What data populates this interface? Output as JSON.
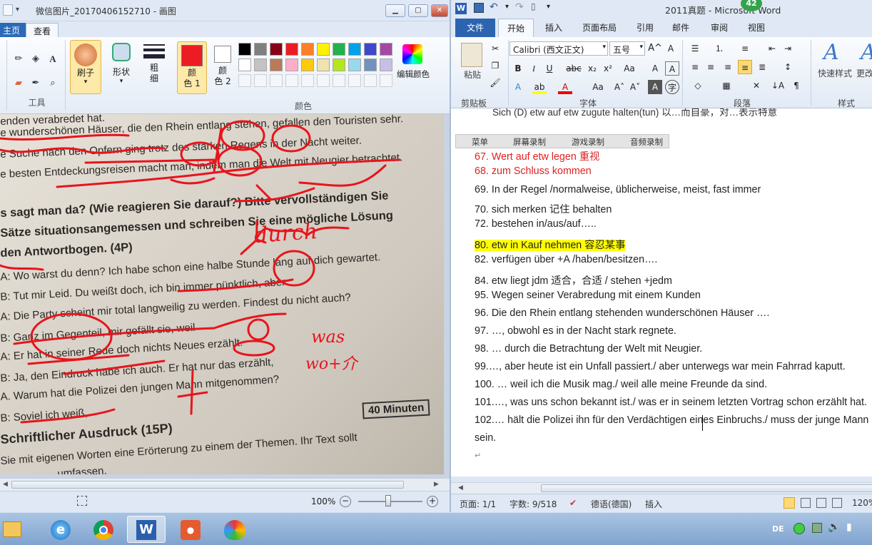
{
  "paint": {
    "title": "微信图片_20170406152710 - 画图",
    "tabs": [
      "主页",
      "查看"
    ],
    "tools_group": "工具",
    "brush_label": "刷子",
    "shapes_label": "形状",
    "size_label": "粗\n细",
    "color1_label": "颜\n色 1",
    "color2_label": "颜\n色 2",
    "colors_group": "颜色",
    "edit_colors_label": "编辑颜色",
    "zoom": "100%",
    "palette": [
      "#000000",
      "#7f7f7f",
      "#880015",
      "#ed1c24",
      "#ff7f27",
      "#fff200",
      "#22b14c",
      "#00a2e8",
      "#3f48cc",
      "#a349a4",
      "#ffffff",
      "#c3c3c3",
      "#b97a57",
      "#ffaec9",
      "#ffc90e",
      "#efe4b0",
      "#b5e61d",
      "#99d9ea",
      "#7092be",
      "#c8bfe7"
    ],
    "color1": "#ed1c24",
    "color2": "#ffffff",
    "photo_lines": [
      "enden verabredet hat.",
      "e wunderschönen Häuser, die den Rhein entlang stehen, gefallen den Touristen sehr.",
      "e Suche nach den Opfern ging trotz des starken Regens in der Nacht weiter.",
      "e besten Entdeckungsreisen macht man, indem man die Welt mit Neugier betrachtet.",
      "s sagt man da? (Wie reagieren Sie darauf?) Bitte vervollständigen Sie",
      "Sätze situationsangemessen und schreiben Sie eine mögliche Lösung",
      "den Antwortbogen. (4P)",
      "A: Wo warst du denn? Ich habe schon eine halbe Stunde lang auf dich gewartet.",
      "B: Tut mir Leid. Du weißt doch, ich bin immer pünktlich, aber",
      "A: Die Party scheint mir total langweilig zu werden. Findest du nicht auch?",
      "B: Ganz im Gegenteil, mir gefällt sie, weil",
      "A: Er hat in seiner Rede doch nichts Neues erzählt.",
      "B: Ja, den Eindruck habe ich auch. Er hat nur das erzählt,",
      "A. Warum hat die Polizei den jungen Mann mitgenommen?",
      "B: Soviel ich weiß,",
      "Schriftlicher Ausdruck  (15P)",
      "Sie mit eigenen Worten eine Erörterung zu einem der Themen. Ihr Text sollt",
      "umfassen."
    ],
    "minuten_box": "40 Minuten",
    "handwriting": [
      "durch",
      "was",
      "wo+介"
    ]
  },
  "word": {
    "title": "2011真题 - Microsoft Word",
    "badge": "42",
    "tabs": [
      "文件",
      "开始",
      "插入",
      "页面布局",
      "引用",
      "邮件",
      "审阅",
      "视图"
    ],
    "font_name": "Calibri (西文正文)",
    "font_size": "五号",
    "paste_label": "粘贴",
    "clipboard_group": "剪贴板",
    "font_group": "字体",
    "paragraph_group": "段落",
    "styles_group": "样式",
    "quick_styles": "快速样式",
    "change_styles": "更改",
    "recorder": [
      "菜单",
      "屏幕录制",
      "游戏录制",
      "音频录制"
    ],
    "doc_top_partial": "Sich (D) etw auf etw zugute halten(tun)  以…而自豪，对…表示特意",
    "doc_lines": [
      "67.   Wert auf etw legen  重视",
      "68. zum Schluss kommen",
      "69.   In der Regel /normalweise, üblicherweise, meist, fast immer",
      "70.     sich merken  记住  behalten",
      "72. bestehen in/aus/auf…..",
      "80. etw in Kauf nehmen  容忍某事",
      "82. verfügen über +A /haben/besitzen….",
      "84. etw liegt jdm  适合，合适     / stehen +jedm",
      "95. Wegen seiner Verabredung mit einem Kunden",
      "96. Die den Rhein entlang stehenden wunderschönen Häuser ….",
      "97. …, obwohl es in der Nacht stark regnete.",
      "98. … durch die Betrachtung der Welt mit Neugier.",
      "99.…, aber heute ist ein Unfall passiert./ aber unterwegs war mein Fahrrad kaputt.",
      "100. … weil ich die Musik mag./ weil alle meine Freunde da sind.",
      "101.…, was uns schon bekannt ist./ was er in seinem letzten Vortrag schon erzählt hat.",
      "102.… hält die Polizei ihn für den Verdächtigen eines Einbruchs./ muss der junge Mann",
      "sein."
    ],
    "status": {
      "page": "页面: 1/1",
      "words": "字数: 9/518",
      "lang": "德语(德国)",
      "mode": "插入",
      "zoom": "120%"
    }
  },
  "taskbar": {
    "ime": "DE",
    "icons": [
      "folder-icon",
      "ie-icon",
      "chrome-icon",
      "word-icon",
      "ppt-recorder-icon",
      "paint-icon"
    ]
  }
}
